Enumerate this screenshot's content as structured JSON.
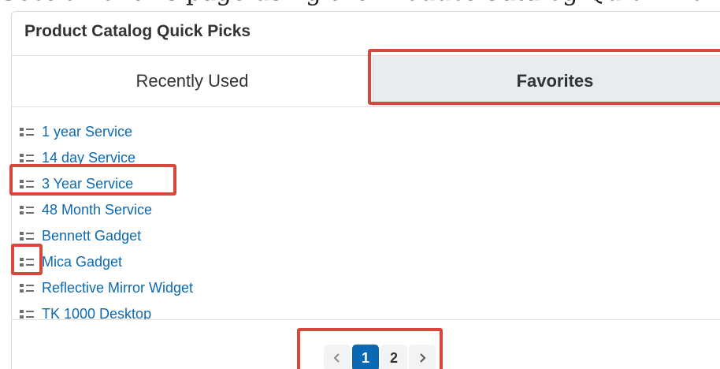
{
  "page": {
    "caption": "Section of this page using the Product Catalog Quick Picks"
  },
  "dashlet": {
    "title": "Product Catalog Quick Picks",
    "tabs": [
      {
        "label": "Recently Used",
        "selected": false
      },
      {
        "label": "Favorites",
        "selected": true
      }
    ],
    "items": [
      {
        "label": "1 year Service",
        "icon": "drag-handle-icon"
      },
      {
        "label": "14 day Service",
        "icon": "drag-handle-icon"
      },
      {
        "label": "3 Year Service",
        "icon": "drag-handle-icon"
      },
      {
        "label": "48 Month Service",
        "icon": "drag-handle-icon"
      },
      {
        "label": "Bennett Gadget",
        "icon": "drag-handle-icon"
      },
      {
        "label": "Mica Gadget",
        "icon": "drag-handle-icon"
      },
      {
        "label": "Reflective Mirror Widget",
        "icon": "drag-handle-icon"
      },
      {
        "label": "TK 1000 Desktop",
        "icon": "drag-handle-icon"
      }
    ],
    "pagination": {
      "pages": [
        "1",
        "2"
      ],
      "current_page": "1",
      "prev_icon": "chevron-left-icon",
      "next_icon": "chevron-right-icon"
    }
  },
  "colors": {
    "link": "#0b69b3",
    "active_tab_bg": "#e9ecef",
    "highlight_border": "#d8473b",
    "active_page_bg": "#0b69b3"
  }
}
